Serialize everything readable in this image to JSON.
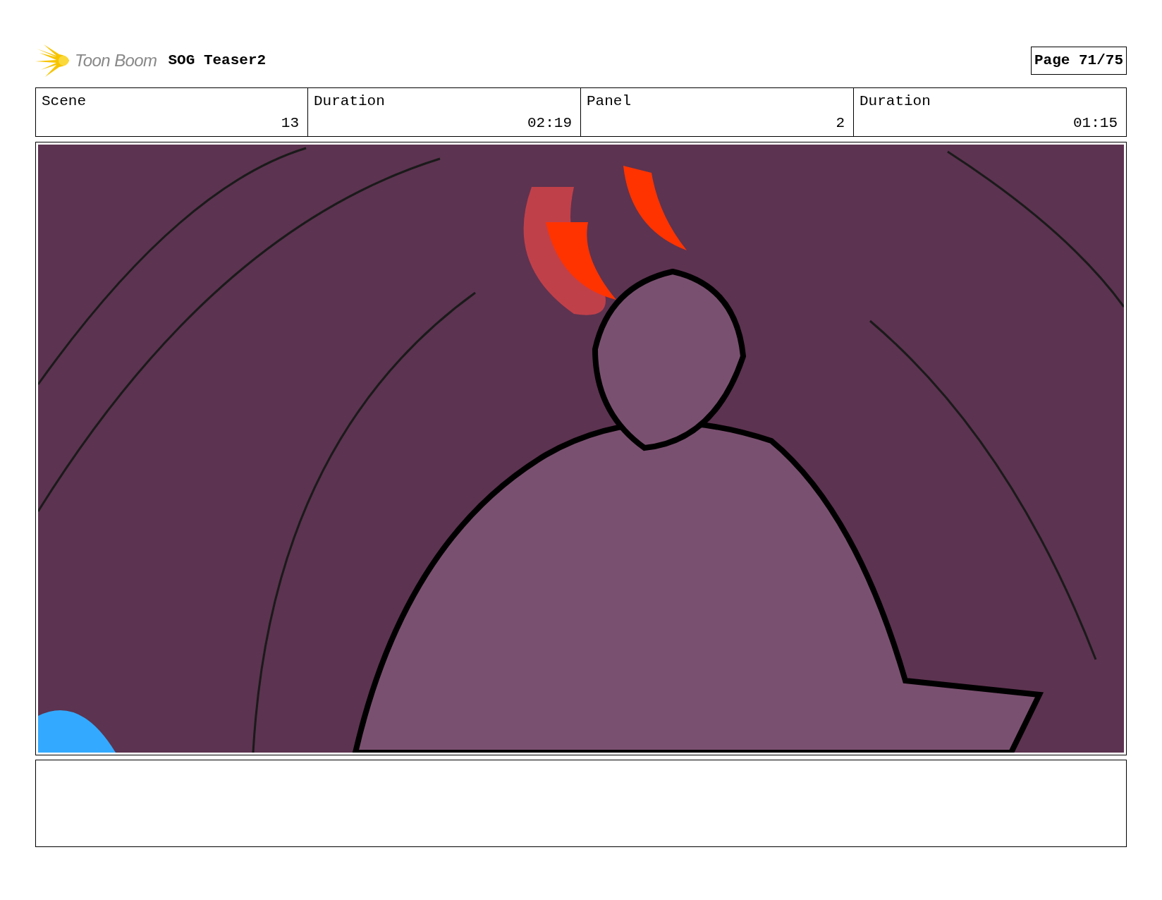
{
  "header": {
    "logo": "Toon Boom",
    "title": "SOG Teaser2",
    "page": "Page 71/75"
  },
  "fields": [
    {
      "label": "Scene",
      "value": "13"
    },
    {
      "label": "Duration",
      "value": "02:19"
    },
    {
      "label": "Panel",
      "value": "2"
    },
    {
      "label": "Duration",
      "value": "01:15"
    }
  ]
}
